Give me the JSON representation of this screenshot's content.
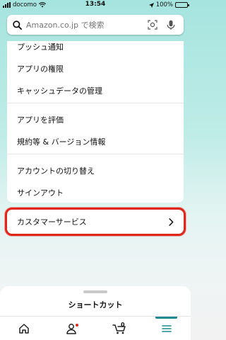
{
  "status_bar": {
    "carrier": "docomo",
    "time": "13:54",
    "battery": "100%"
  },
  "search": {
    "placeholder": "Amazon.co.jp で検索"
  },
  "menu": {
    "items": [
      {
        "label": "プッシュ通知"
      },
      {
        "label": "アプリの権限"
      },
      {
        "label": "キャッシュデータの管理"
      },
      {
        "label": "アプリを評価"
      },
      {
        "label": "規約等 & バージョン情報"
      },
      {
        "label": "アカウントの切り替え"
      },
      {
        "label": "サインアウト"
      }
    ]
  },
  "customer_service": {
    "label": "カスタマーサービス"
  },
  "bottom_sheet": {
    "title": "ショートカット"
  },
  "tab_bar": {
    "cart_count": "0"
  },
  "colors": {
    "accent": "#1f8a8f",
    "highlight": "#e0271b"
  }
}
